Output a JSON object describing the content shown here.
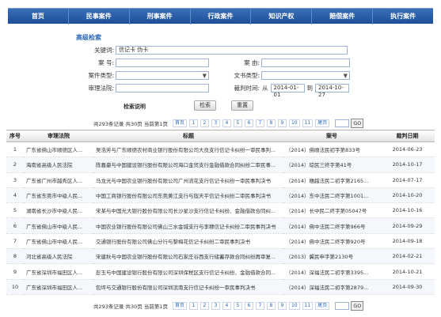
{
  "nav": {
    "items": [
      "首页",
      "民事案件",
      "刑事案件",
      "行政案件",
      "知识产权",
      "赔偿案件",
      "执行案件"
    ]
  },
  "search": {
    "title": "高级检索",
    "keyword_label": "关键词:",
    "keyword_value": "信记卡 伪卡",
    "case_no_label": "案  号:",
    "cause_label": "案  由:",
    "case_type_label": "案件类型:",
    "doc_type_label": "文书类型:",
    "court_label": "审理法院:",
    "date_label": "裁判时间:",
    "date_from_label": "从",
    "date_from": "2014-01-01",
    "date_to_label": "到",
    "date_to": "2014-10-27",
    "help_label": "检索说明",
    "search_button": "检索",
    "reset_button": "重置"
  },
  "pager": {
    "count": "共293条记录  共30页  当前第1页",
    "first": "首页",
    "pages": [
      "1",
      "2",
      "3",
      "4",
      "5",
      "6",
      "7",
      "8",
      "9",
      "10",
      "11"
    ],
    "last": "尾页",
    "go": "GO"
  },
  "table": {
    "headers": [
      "序号",
      "审理法院",
      "标题",
      "案号",
      "裁判日期"
    ],
    "rows": [
      [
        "1",
        "广东省佛山市顺德区人...",
        "吴浩芳与广东顺德农村商业银行股份有限公司大良支行信记卡纠纷一审民事判...",
        "（2014）佛顺法民初字第833号",
        "2014-06-23"
      ],
      [
        "2",
        "海南省高级人民法院",
        "陈嘉豪与中国建设银行股份有限公司海口金贸支行金融借款合同纠纷二审民事...",
        "（2014）琼民三终字第41号",
        "2014-10-17"
      ],
      [
        "3",
        "广东省广州市越秀区人...",
        "马龙光与中国农业银行股份有限公司广州流花支行信记卡纠纷一审民事判决书",
        "（2014）穗越法民二初字第2165...",
        "2014-07-17"
      ],
      [
        "4",
        "广东省东莞市中级人民...",
        "中国工商银行股份有限公司东莞黄江支行与寇天平信记卡纠纷二审民事判决书",
        "（2014）东中法民二终字第1001...",
        "2014-10-20"
      ],
      [
        "5",
        "湖南省长沙市中级人民...",
        "宋某与中国光大银行股份有限公司长沙星沙支行信记卡纠纷、金融借款合同纠...",
        "（2014）长中民二终字第05047号",
        "2014-10-16"
      ],
      [
        "6",
        "广东省佛山市中级人民...",
        "中国农业银行股份有限公司佛山三水金城支行与李穆信记卡纠纷二审民事判决书",
        "（2014）佛中法民二终字第966号",
        "2014-09-29"
      ],
      [
        "7",
        "广东省佛山市中级人民...",
        "交通银行股份有限公司佛山分行与黎梅花信记卡纠纷二审民事判决书",
        "（2014）佛中法民二终字第920号",
        "2014-09-18"
      ],
      [
        "8",
        "河北省高级人民法院",
        "宋建秋与中国农业银行股份有限公司石家庄谷西支行储蓄存款合同纠纷再审复...",
        "（2013）冀民申字第2130号",
        "2014-02-21"
      ],
      [
        "9",
        "广东省深圳市福田区人...",
        "彭玉与中国建设银行股份有限公司深圳保税区支行信记卡纠纷、金融借款合同...",
        "（2014）深福法民二初字第3395...",
        "2014-10-21"
      ],
      [
        "10",
        "广东省深圳市福田区人...",
        "包坪与交通银行股份有限公司深圳滨南支行信记卡纠纷一审民事判决书",
        "（2014）深福法民二初字第2879...",
        "2014-09-30"
      ]
    ]
  },
  "colors": {
    "nav_bg": "#2b5fa8",
    "link": "#2d6ab4"
  }
}
